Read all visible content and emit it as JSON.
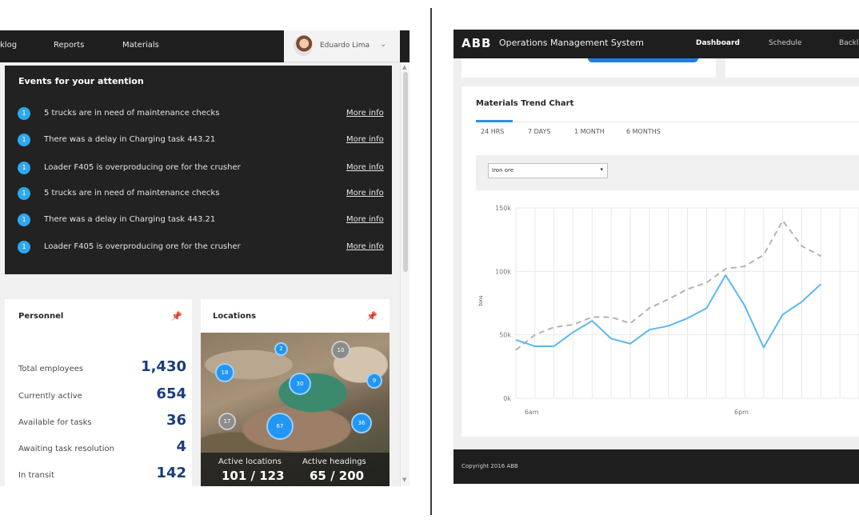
{
  "left_screen": {
    "nav": {
      "items": [
        "klog",
        "Reports",
        "Materials"
      ],
      "user_name": "Eduardo Lima",
      "user_chevron": "chevron-down-icon"
    },
    "events": {
      "title": "Events for your attention",
      "items": [
        {
          "badge": "1",
          "text": "5 trucks are in need of maintenance checks",
          "link": "More info"
        },
        {
          "badge": "1",
          "text": "There was a delay in Charging task 443.21",
          "link": "More info"
        },
        {
          "badge": "1",
          "text": "Loader F405 is overproducing ore for the crusher",
          "link": "More info"
        },
        {
          "badge": "1",
          "text": "5 trucks are in need of maintenance checks",
          "link": "More info"
        },
        {
          "badge": "1",
          "text": "There was a delay in Charging task 443.21",
          "link": "More info"
        },
        {
          "badge": "1",
          "text": "Loader F405 is overproducing ore for the crusher",
          "link": "More info"
        }
      ]
    },
    "personnel": {
      "title": "Personnel",
      "pin_icon": "pin-icon",
      "rows": [
        {
          "label": "Total employees",
          "value": "1,430"
        },
        {
          "label": "Currently active",
          "value": "654"
        },
        {
          "label": "Available for tasks",
          "value": "36"
        },
        {
          "label": "Awaiting task resolution",
          "value": "4"
        },
        {
          "label": "In transit",
          "value": "142"
        }
      ]
    },
    "locations": {
      "title": "Locations",
      "pin_icon": "pin-icon",
      "clusters": [
        "2",
        "10",
        "18",
        "30",
        "9",
        "17",
        "67",
        "36"
      ],
      "active_locations_label": "Active locations",
      "active_locations_value": "101 / 123",
      "active_headings_label": "Active headings",
      "active_headings_value": "65 / 200"
    }
  },
  "right_screen": {
    "header": {
      "logo": "ABB",
      "app_title": "Operations Management System",
      "nav": [
        "Dashboard",
        "Schedule",
        "Backl"
      ],
      "active_nav": "Dashboard"
    },
    "chart_card": {
      "title": "Materials Trend Chart",
      "tabs": [
        "24 HRS",
        "7 DAYS",
        "1 MONTH",
        "6 MONTHS"
      ],
      "active_tab": "24 HRS",
      "material_select": "Iron ore"
    },
    "footer": {
      "copyright": "Copyright 2016 ABB"
    }
  },
  "chart_data": {
    "type": "line",
    "title": "",
    "xlabel": "",
    "ylabel": "tons",
    "x_tick_labels": [
      "6am",
      "6pm"
    ],
    "y_tick_labels": [
      "0k",
      "50k",
      "100k",
      "150k"
    ],
    "ylim": [
      0,
      150000
    ],
    "grid": true,
    "colors": {
      "actual": "#5bb8f0",
      "planned": "#b3b3b3"
    },
    "x": [
      0,
      1,
      2,
      3,
      4,
      5,
      6,
      7,
      8,
      9,
      10,
      11,
      12,
      13,
      14,
      15,
      16,
      17,
      18
    ],
    "series": [
      {
        "name": "",
        "style": "solid",
        "values": [
          46000,
          41000,
          41000,
          52000,
          61000,
          47000,
          43000,
          54000,
          57000,
          63000,
          71000,
          97000,
          73000,
          40000,
          66000,
          76000,
          90000,
          null,
          null
        ]
      },
      {
        "name": "",
        "style": "dashed",
        "values": [
          38000,
          50000,
          56000,
          58000,
          64000,
          64000,
          59000,
          71000,
          78000,
          86000,
          91000,
          102000,
          104000,
          113000,
          140000,
          120000,
          112000,
          null,
          null
        ]
      }
    ]
  }
}
